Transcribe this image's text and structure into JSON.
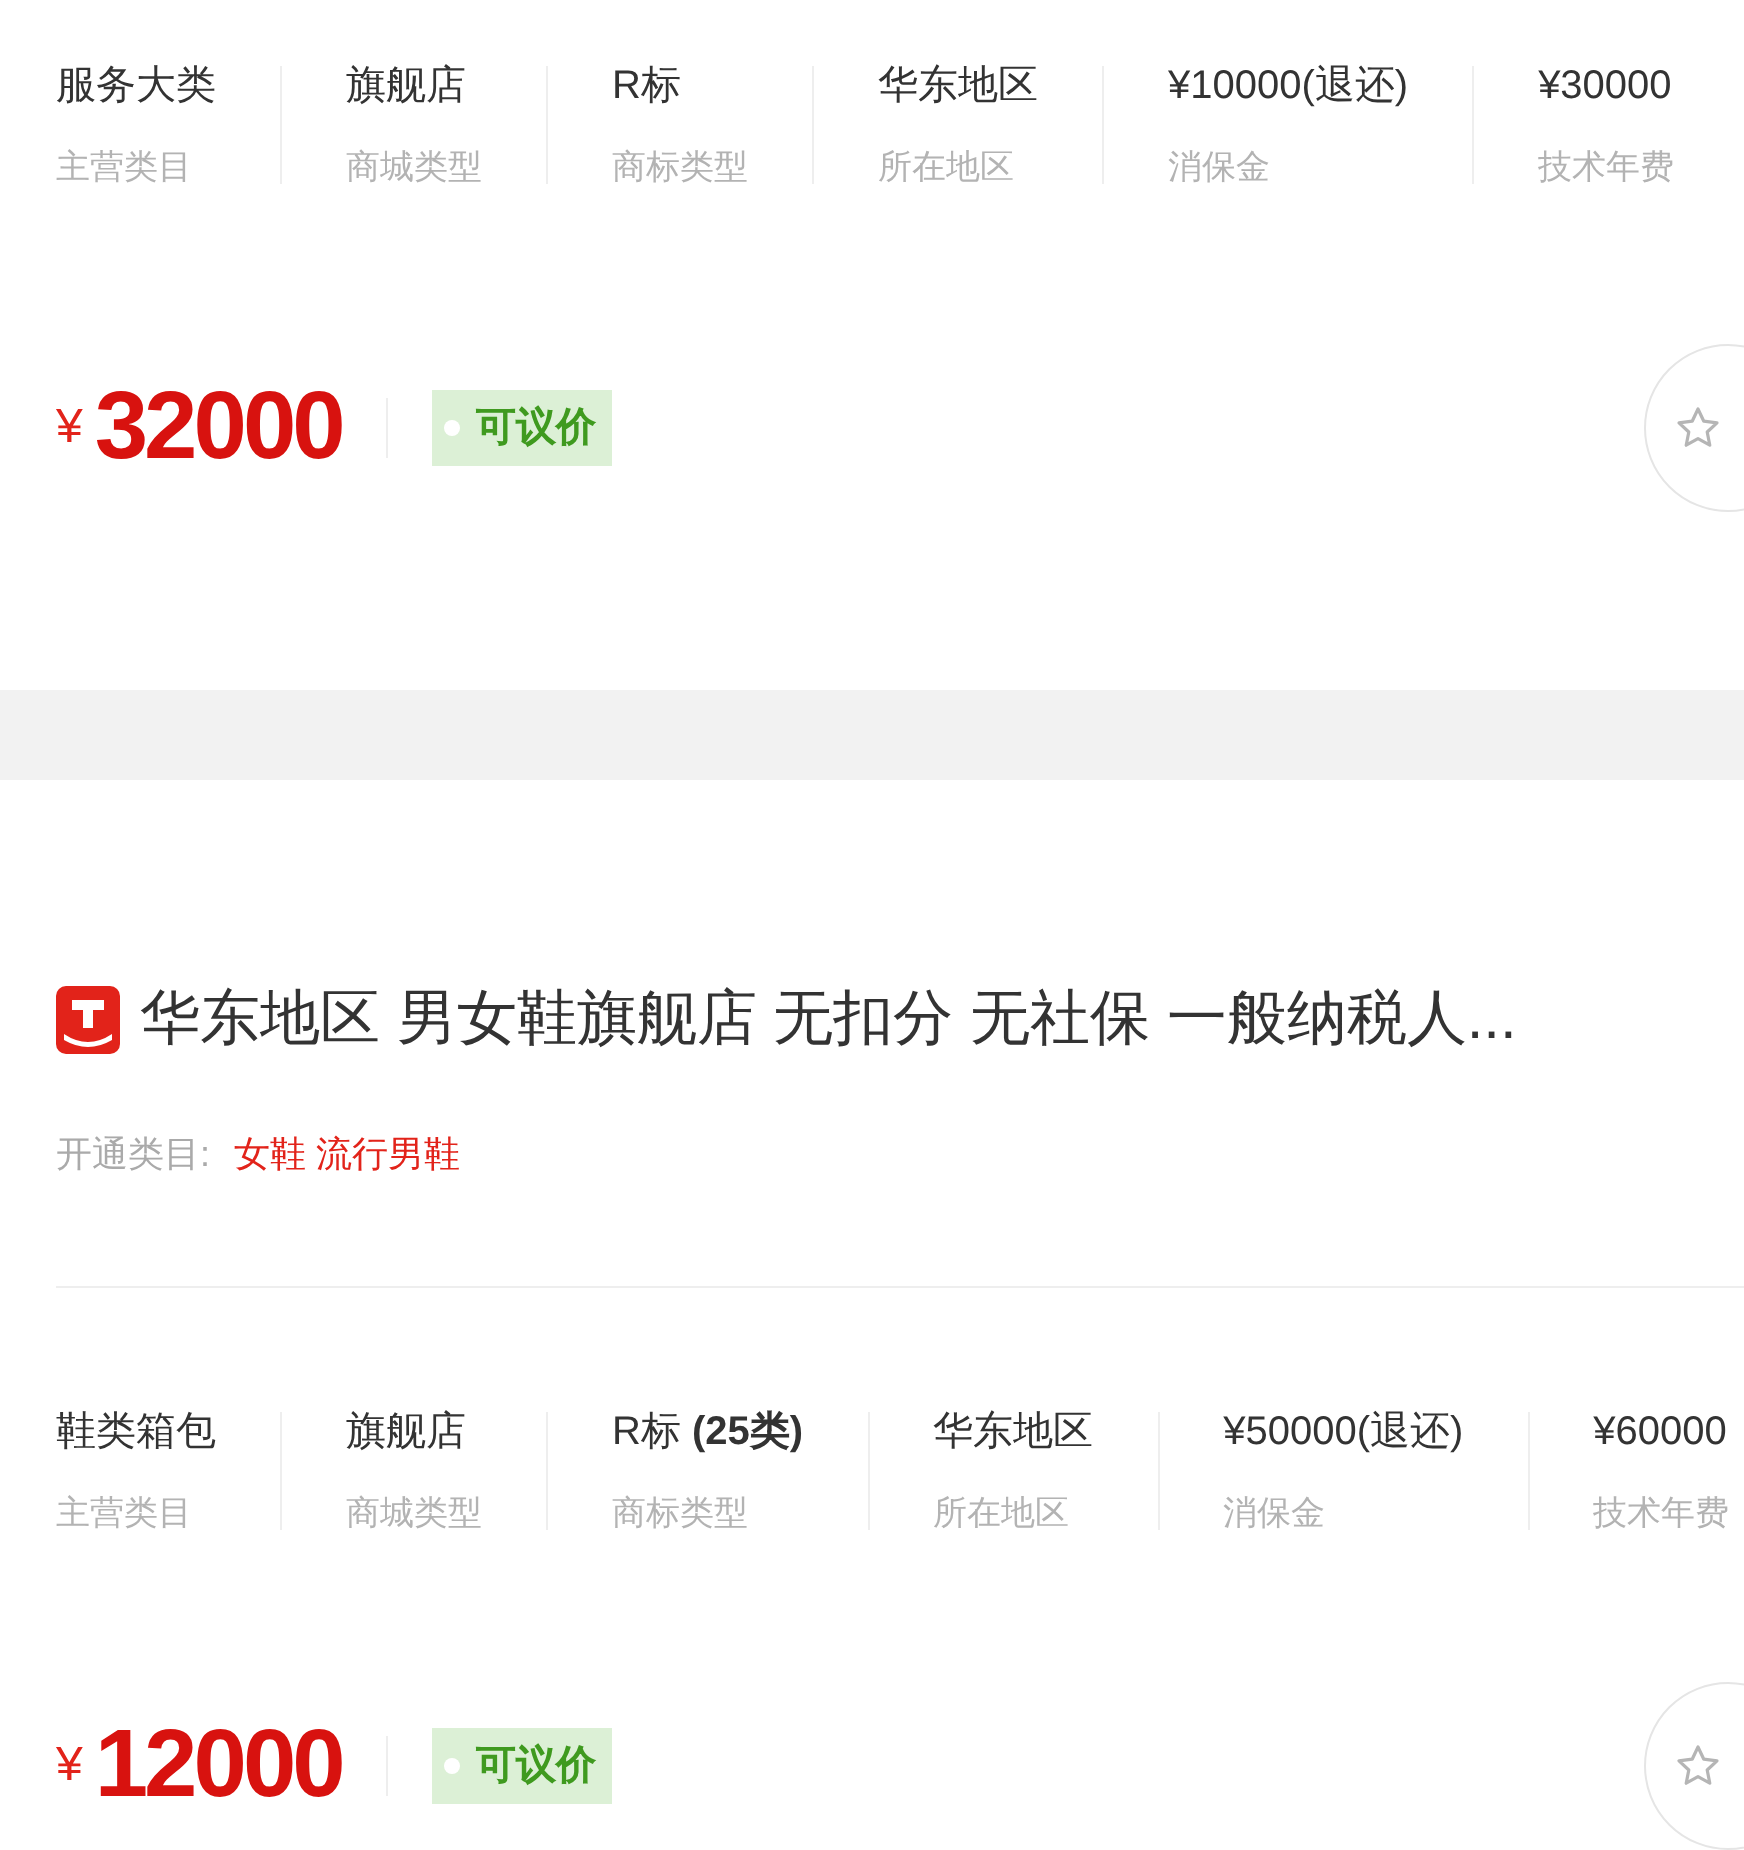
{
  "listings": [
    {
      "stats": [
        {
          "value": "服务大类",
          "label": "主营类目"
        },
        {
          "value": "旗舰店",
          "label": "商城类型"
        },
        {
          "value": "R标",
          "label": "商标类型"
        },
        {
          "value": "华东地区",
          "label": "所在地区"
        },
        {
          "value": "¥10000(退还)",
          "label": "消保金"
        },
        {
          "value": "¥30000",
          "label": "技术年费"
        }
      ],
      "price": {
        "currency": "¥",
        "amount": "32000"
      },
      "tag": "可议价"
    },
    {
      "title": "华东地区 男女鞋旗舰店 无扣分 无社保 一般纳税人...",
      "categories_label": "开通类目:",
      "categories": "女鞋 流行男鞋",
      "stats": [
        {
          "value": "鞋类箱包",
          "label": "主营类目"
        },
        {
          "value": "旗舰店",
          "label": "商城类型"
        },
        {
          "value": "R标 **(25类)**",
          "label": "商标类型"
        },
        {
          "value": "华东地区",
          "label": "所在地区"
        },
        {
          "value": "¥50000(退还)",
          "label": "消保金"
        },
        {
          "value": "¥60000",
          "label": "技术年费"
        }
      ],
      "price": {
        "currency": "¥",
        "amount": "12000"
      },
      "tag": "可议价"
    }
  ]
}
